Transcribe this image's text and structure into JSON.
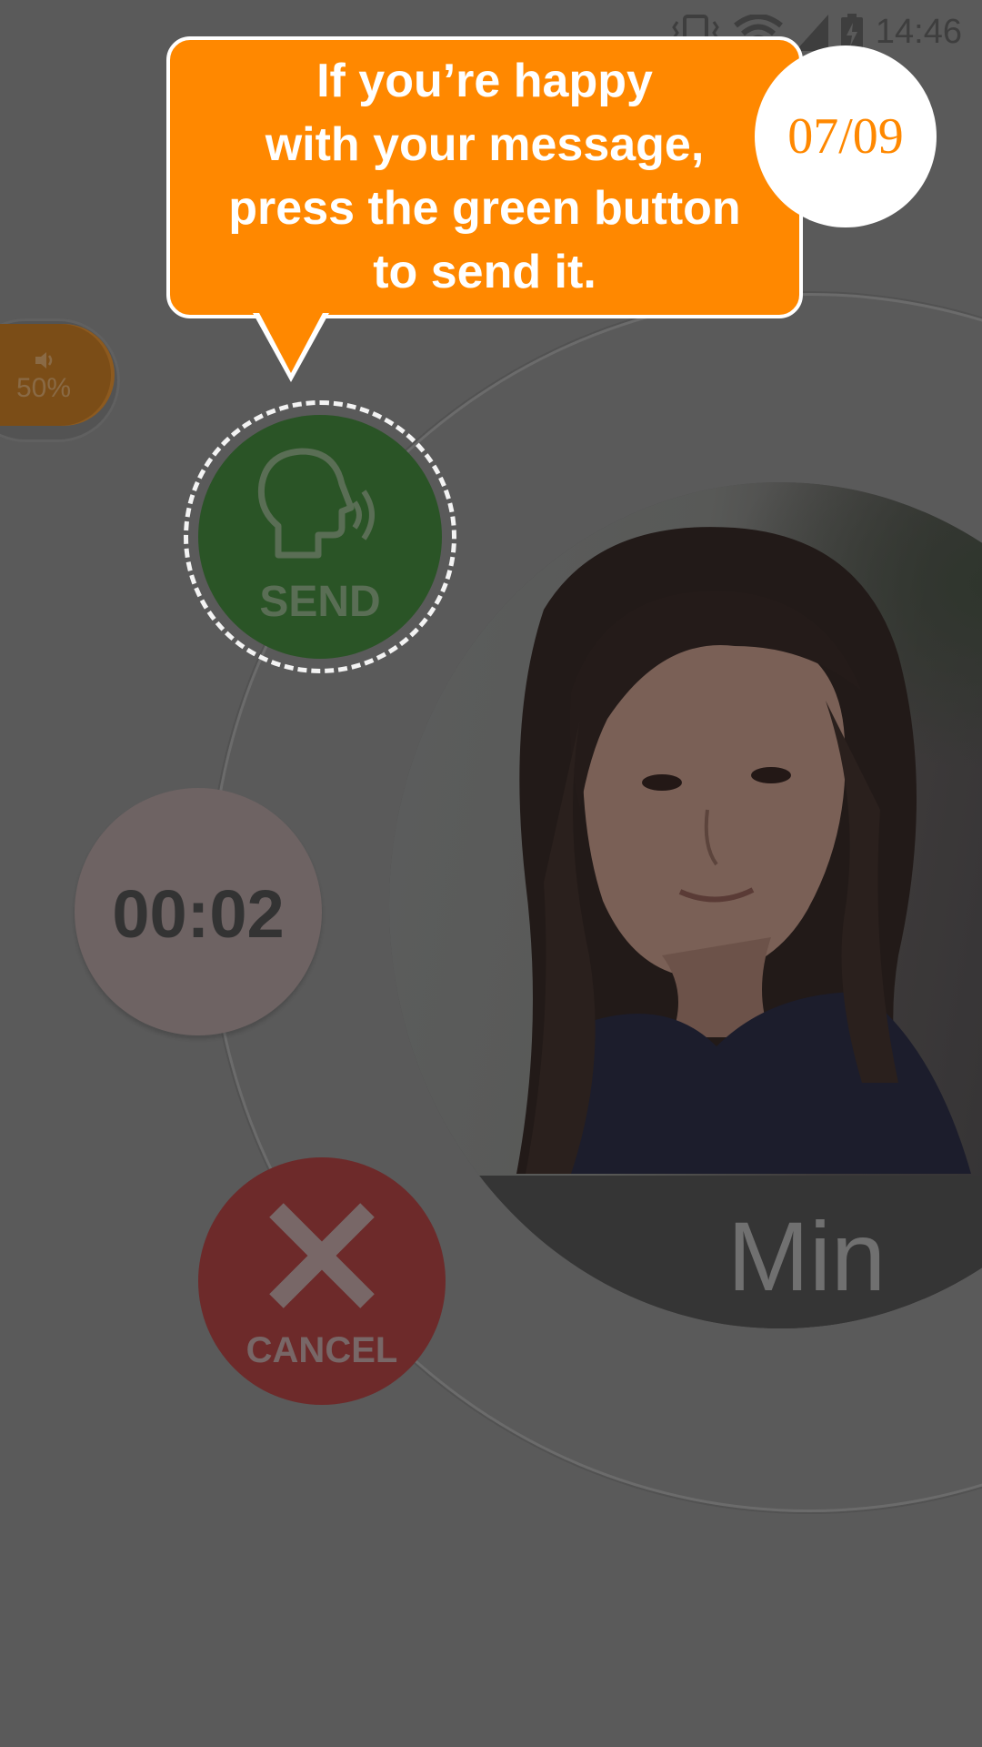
{
  "status_bar": {
    "time": "14:46",
    "icons": [
      "vibrate-icon",
      "wifi-icon",
      "signal-icon",
      "battery-charging-icon"
    ]
  },
  "volume": {
    "label": "50%",
    "icon": "speaker-icon",
    "level": 0.5
  },
  "send_button": {
    "label": "SEND",
    "icon": "speaking-head-icon"
  },
  "timer": {
    "value": "00:02"
  },
  "cancel_button": {
    "label": "CANCEL",
    "icon": "close-x-icon"
  },
  "contact": {
    "name": "Min"
  },
  "tutorial": {
    "message": "If you’re happy\nwith your message,\npress the green button\nto send it.",
    "step": "07/09"
  },
  "colors": {
    "accent": "#ff8800",
    "send_green": "#2a5426",
    "cancel_red": "#6d2a2a",
    "overlay": "#5a5a5a"
  }
}
